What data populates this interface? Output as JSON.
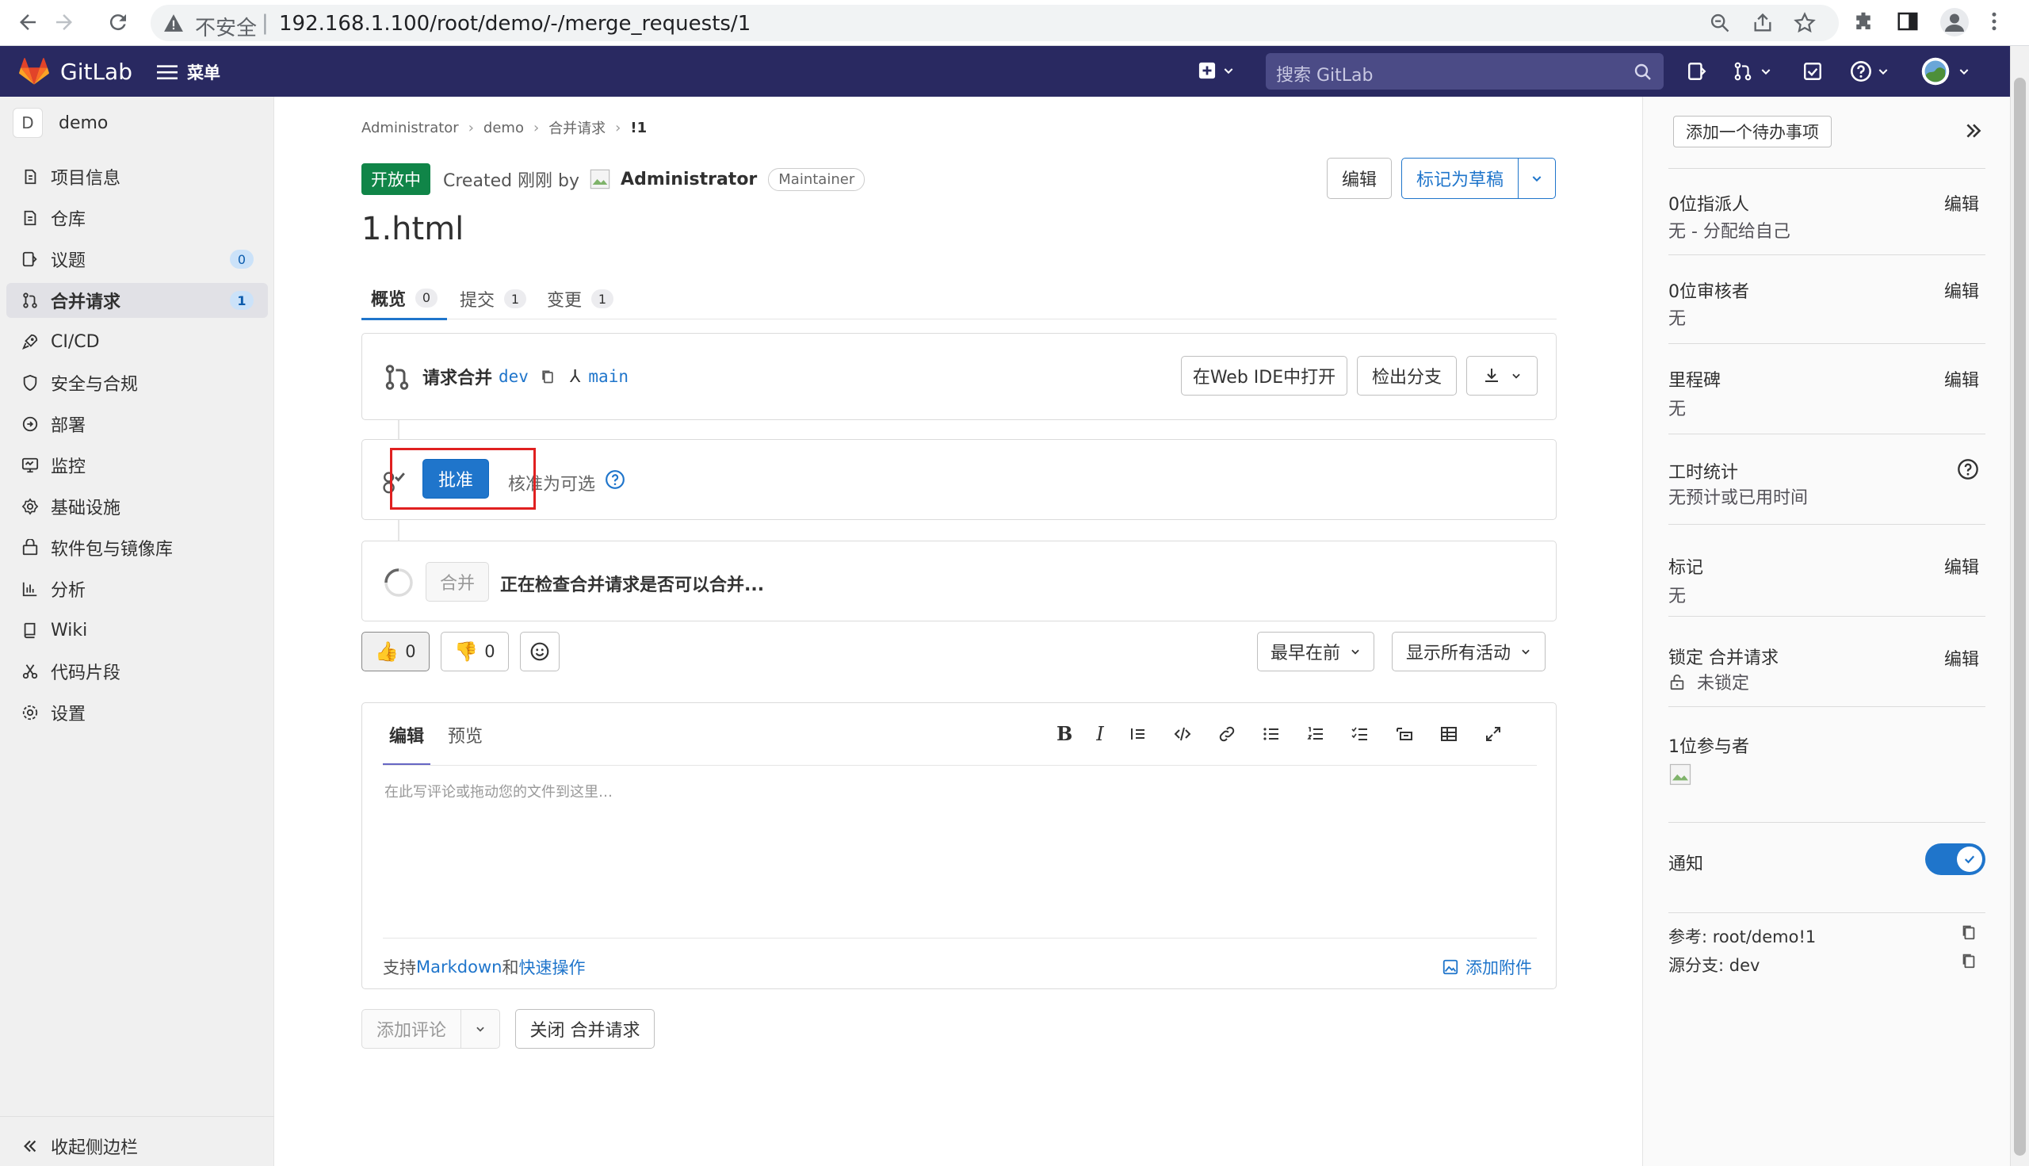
{
  "browser": {
    "insecure_label": "不安全",
    "separator": "|",
    "url": "192.168.1.100/root/demo/-/merge_requests/1"
  },
  "header": {
    "brand": "GitLab",
    "menu_label": "菜单",
    "search_placeholder": "搜索 GitLab"
  },
  "sidebar": {
    "project_initial": "D",
    "project_name": "demo",
    "items": [
      {
        "label": "项目信息",
        "icon": "info-icon"
      },
      {
        "label": "仓库",
        "icon": "doc-icon"
      },
      {
        "label": "议题",
        "icon": "issues-icon",
        "badge": "0"
      },
      {
        "label": "合并请求",
        "icon": "merge-request-icon",
        "badge": "1"
      },
      {
        "label": "CI/CD",
        "icon": "rocket-icon"
      },
      {
        "label": "安全与合规",
        "icon": "shield-icon"
      },
      {
        "label": "部署",
        "icon": "deploy-icon"
      },
      {
        "label": "监控",
        "icon": "monitor-icon"
      },
      {
        "label": "基础设施",
        "icon": "cloud-gear-icon"
      },
      {
        "label": "软件包与镜像库",
        "icon": "package-icon"
      },
      {
        "label": "分析",
        "icon": "chart-icon"
      },
      {
        "label": "Wiki",
        "icon": "book-icon"
      },
      {
        "label": "代码片段",
        "icon": "scissors-icon"
      },
      {
        "label": "设置",
        "icon": "gear-icon"
      }
    ],
    "collapse_label": "收起侧边栏"
  },
  "breadcrumb": [
    "Administrator",
    "demo",
    "合并请求",
    "!1"
  ],
  "mr": {
    "status": "开放中",
    "created_text": "Created 刚刚 by",
    "author": "Administrator",
    "role": "Maintainer",
    "title": "1.html",
    "edit_label": "编辑",
    "mark_draft_label": "标记为草稿"
  },
  "tabs": [
    {
      "label": "概览",
      "count": "0"
    },
    {
      "label": "提交",
      "count": "1"
    },
    {
      "label": "变更",
      "count": "1"
    }
  ],
  "branch_box": {
    "request_label": "请求合并",
    "source": "dev",
    "target": "main",
    "web_ide_label": "在Web IDE中打开",
    "checkout_label": "检出分支"
  },
  "approval": {
    "approve_label": "批准",
    "optional_text": "核准为可选"
  },
  "merge_box": {
    "merge_label": "合并",
    "checking_text": "正在检查合并请求是否可以合并..."
  },
  "reactions": {
    "thumbs_up": "0",
    "thumbs_down": "0",
    "sort_label": "最早在前",
    "filter_label": "显示所有活动"
  },
  "comment": {
    "tab_edit": "编辑",
    "tab_preview": "预览",
    "placeholder": "在此写评论或拖动您的文件到这里…",
    "supports_text": "支持",
    "markdown_link": "Markdown",
    "and_text": "和",
    "quick_actions_link": "快速操作",
    "attach_label": "添加附件",
    "add_comment_label": "添加评论",
    "close_mr_label": "关闭 合并请求"
  },
  "right_sidebar": {
    "todo_label": "添加一个待办事项",
    "assignee_title": "0位指派人",
    "assignee_value": "无 - 分配给自己",
    "reviewer_title": "0位审核者",
    "reviewer_value": "无",
    "milestone_title": "里程碑",
    "milestone_value": "无",
    "time_title": "工时统计",
    "time_value": "无预计或已用时间",
    "labels_title": "标记",
    "labels_value": "无",
    "lock_title": "锁定 合并请求",
    "lock_value": "未锁定",
    "participants_title": "1位参与者",
    "notify_title": "通知",
    "notify_on": true,
    "edit_label": "编辑",
    "reference_label": "参考: root/demo!1",
    "source_branch_label": "源分支: dev"
  },
  "colors": {
    "header_bg": "#292961",
    "accent": "#1f75cb",
    "open_badge": "#108548",
    "highlight_box": "#e02020"
  }
}
